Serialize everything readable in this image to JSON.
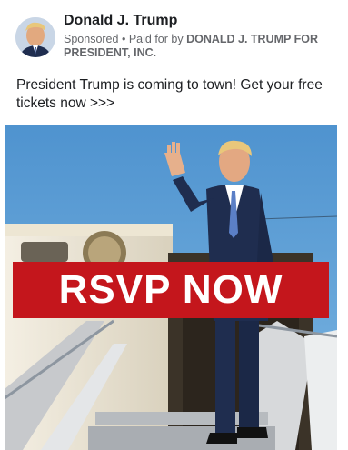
{
  "ad": {
    "page_name": "Donald J. Trump",
    "sponsored_label": "Sponsored",
    "separator": "•",
    "paid_for_prefix": "Paid for by",
    "paid_for_entity": "DONALD J. TRUMP FOR PRESIDENT, INC.",
    "post_text": "President Trump is coming to town! Get your free tickets now >>>",
    "banner_text": "RSVP NOW"
  },
  "colors": {
    "banner": "#c4161c",
    "sky": "#5f9fd3",
    "suit": "#1f2d4f"
  },
  "icons": {
    "avatar": "profile-photo"
  }
}
